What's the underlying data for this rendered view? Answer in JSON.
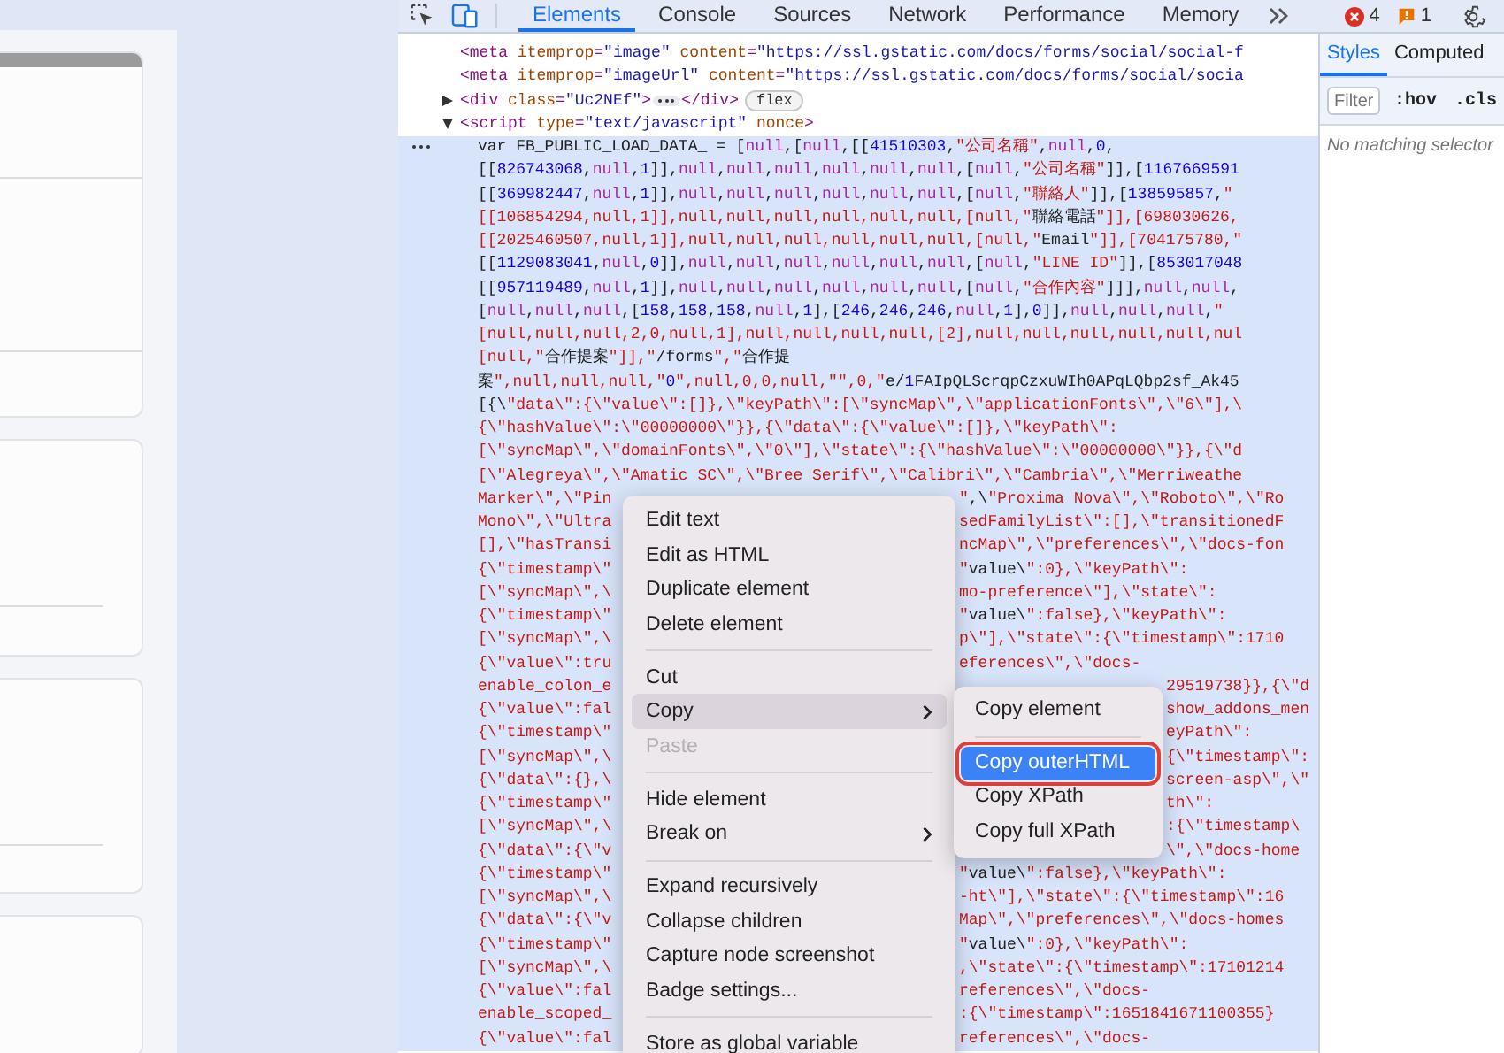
{
  "toolbar": {
    "tabs": [
      {
        "label": "Elements",
        "selected": true
      },
      {
        "label": "Console",
        "selected": false
      },
      {
        "label": "Sources",
        "selected": false
      },
      {
        "label": "Network",
        "selected": false
      },
      {
        "label": "Performance",
        "selected": false
      },
      {
        "label": "Memory",
        "selected": false
      }
    ],
    "errors": "4",
    "warnings": "1"
  },
  "elements": {
    "nodes": [
      {
        "kind": "tag",
        "text": "<meta itemprop=\"image\" content=\"https://ssl.gstatic.com/docs/forms/social/social-f"
      },
      {
        "kind": "tag",
        "text": "<meta itemprop=\"imageUrl\" content=\"https://ssl.gstatic.com/docs/forms/social/socia"
      },
      {
        "kind": "collapsed",
        "expanded": false,
        "text": "<div class=\"Uc2NEf\">",
        "close": "</div>",
        "badge": "flex"
      },
      {
        "kind": "parent",
        "expanded": true,
        "text": "<script type=\"text/javascript\" nonce>"
      }
    ],
    "text_node": {
      "selected": true,
      "lines": [
        {
          "kind": "full",
          "text": "var FB_PUBLIC_LOAD_DATA_ = [null,[null,[[41510303,\"公司名稱\",null,0,"
        },
        {
          "kind": "full",
          "text": "[[826743068,null,1]],null,null,null,null,null,null,[null,\"公司名稱\"]],[1167669591"
        },
        {
          "kind": "full",
          "text": "[[369982447,null,1]],null,null,null,null,null,null,[null,\"聯絡人\"]],[138595857,\""
        },
        {
          "kind": "full",
          "text": "[[106854294,null,1]],null,null,null,null,null,null,[null,\"聯絡電話\"]],[698030626,"
        },
        {
          "kind": "full",
          "text": "[[2025460507,null,1]],null,null,null,null,null,null,[null,\"Email\"]],[704175780,\""
        },
        {
          "kind": "full",
          "text": "[[1129083041,null,0]],null,null,null,null,null,null,[null,\"LINE ID\"]],[853017048"
        },
        {
          "kind": "full",
          "text": "[[957119489,null,1]],null,null,null,null,null,null,[null,\"合作內容\"]]],null,null,"
        },
        {
          "kind": "full",
          "text": "[null,null,null,[158,158,158,null,1],[246,246,246,null,1],0]],null,null,null,\""
        },
        {
          "kind": "full",
          "text": "[null,null,null,2,0,null,1],null,null,null,null,[2],null,null,null,null,null,nul"
        },
        {
          "kind": "full",
          "text": "[null,\"合作提案\"]],\"/forms\",\"合作提"
        },
        {
          "kind": "full",
          "text": "案\",null,null,null,\"0\",null,0,0,null,\"\",0,\"e/1FAIpQLScrqpCzxuWIh0APqLQbp2sf_Ak45"
        },
        {
          "kind": "full",
          "text": "[{\\\"data\\\":{\\\"value\\\":[]},\\\"keyPath\\\":[\\\"syncMap\\\",\\\"applicationFonts\\\",\\\"6\\\"],\\"
        },
        {
          "kind": "full",
          "text": "{\\\"hashValue\\\":\\\"00000000\\\"}},{\\\"data\\\":{\\\"value\\\":[]},\\\"keyPath\\\":"
        },
        {
          "kind": "full",
          "text": "[\\\"syncMap\\\",\\\"domainFonts\\\",\\\"0\\\"],\\\"state\\\":{\\\"hashValue\\\":\\\"00000000\\\"}},{\\\"d"
        },
        {
          "kind": "full",
          "text": "[\\\"Alegreya\\\",\\\"Amatic SC\\\",\\\"Bree Serif\\\",\\\"Calibri\\\",\\\"Cambria\\\",\\\"Merriweathe"
        },
        {
          "kind": "menu",
          "left": "Marker\\\",\\\"Pin",
          "right": "\",\\\"Proxima Nova\\\",\\\"Roboto\\\",\\\"Ro"
        },
        {
          "kind": "menu",
          "left": "Mono\\\",\\\"Ultra",
          "right": "sedFamilyList\\\":[],\\\"transitionedF"
        },
        {
          "kind": "menu",
          "left": "[],\\\"hasTransi",
          "right": "ncMap\\\",\\\"preferences\\\",\\\"docs-fon"
        },
        {
          "kind": "menu",
          "left": "{\\\"timestamp\\\"",
          "right": "\"value\\\":0},\\\"keyPath\\\":"
        },
        {
          "kind": "menu",
          "left": "[\\\"syncMap\\\",\\",
          "right": "mo-preference\\\"],\\\"state\\\":"
        },
        {
          "kind": "menu",
          "left": "{\\\"timestamp\\\"",
          "right": "\"value\\\":false},\\\"keyPath\\\":"
        },
        {
          "kind": "menu",
          "left": "[\\\"syncMap\\\",\\",
          "right": "p\\\"],\\\"state\\\":{\\\"timestamp\\\":1710"
        },
        {
          "kind": "menu",
          "left": "{\\\"value\\\":tru",
          "right": "eferences\\\",\\\"docs-"
        },
        {
          "kind": "submenu",
          "left": "enable_colon_e",
          "right": "29519738}},{\\\"d"
        },
        {
          "kind": "submenu",
          "left": "{\\\"value\\\":fal",
          "right": "show_addons_men"
        },
        {
          "kind": "submenu",
          "left": "{\\\"timestamp\\\"",
          "right": "eyPath\\\":"
        },
        {
          "kind": "submenu",
          "left": "[\\\"syncMap\\\",\\",
          "right": "{\\\"timestamp\\\":"
        },
        {
          "kind": "submenu",
          "left": "{\\\"data\\\":{},\\",
          "right": "screen-asp\\\",\\\""
        },
        {
          "kind": "submenu",
          "left": "{\\\"timestamp\\\"",
          "right": "th\\\":"
        },
        {
          "kind": "submenu",
          "left": "[\\\"syncMap\\\",\\",
          "right": ":{\\\"timestamp\\"
        },
        {
          "kind": "submenu",
          "left": "{\\\"data\\\":{\\\"v",
          "right": "\\\",\\\"docs-home"
        },
        {
          "kind": "menu",
          "left": "{\\\"timestamp\\\"",
          "right": "\"value\\\":false},\\\"keyPath\\\":"
        },
        {
          "kind": "menu",
          "left": "[\\\"syncMap\\\",\\",
          "right": "-ht\\\"],\\\"state\\\":{\\\"timestamp\\\":16"
        },
        {
          "kind": "menu",
          "left": "{\\\"data\\\":{\\\"v",
          "right": "Map\\\",\\\"preferences\\\",\\\"docs-homes"
        },
        {
          "kind": "menu",
          "left": "{\\\"timestamp\\\"",
          "right": "\"value\\\":0},\\\"keyPath\\\":"
        },
        {
          "kind": "menu",
          "left": "[\\\"syncMap\\\",\\",
          "right": ",\\\"state\\\":{\\\"timestamp\\\":17101214"
        },
        {
          "kind": "menu",
          "left": "{\\\"value\\\":fal",
          "right": "references\\\",\\\"docs-"
        },
        {
          "kind": "menu",
          "left": "enable_scoped_",
          "right": ":{\\\"timestamp\\\":1651841671100355}"
        },
        {
          "kind": "menu",
          "left": "{\\\"value\\\":fal",
          "right": "references\\\",\\\"docs-"
        }
      ]
    }
  },
  "context_menu": {
    "items": [
      {
        "kind": "item",
        "label": "Edit text",
        "highlighted": false,
        "disabled": false,
        "submenu": false
      },
      {
        "kind": "item",
        "label": "Edit as HTML",
        "highlighted": false,
        "disabled": false,
        "submenu": false
      },
      {
        "kind": "item",
        "label": "Duplicate element",
        "highlighted": false,
        "disabled": false,
        "submenu": false
      },
      {
        "kind": "item",
        "label": "Delete element",
        "highlighted": false,
        "disabled": false,
        "submenu": false
      },
      {
        "kind": "separator"
      },
      {
        "kind": "item",
        "label": "Cut",
        "highlighted": false,
        "disabled": false,
        "submenu": false
      },
      {
        "kind": "item",
        "label": "Copy",
        "highlighted": true,
        "disabled": false,
        "submenu": true
      },
      {
        "kind": "item",
        "label": "Paste",
        "highlighted": false,
        "disabled": true,
        "submenu": false
      },
      {
        "kind": "separator"
      },
      {
        "kind": "item",
        "label": "Hide element",
        "highlighted": false,
        "disabled": false,
        "submenu": false
      },
      {
        "kind": "item",
        "label": "Break on",
        "highlighted": false,
        "disabled": false,
        "submenu": true
      },
      {
        "kind": "separator"
      },
      {
        "kind": "item",
        "label": "Expand recursively",
        "highlighted": false,
        "disabled": false,
        "submenu": false
      },
      {
        "kind": "item",
        "label": "Collapse children",
        "highlighted": false,
        "disabled": false,
        "submenu": false
      },
      {
        "kind": "item",
        "label": "Capture node screenshot",
        "highlighted": false,
        "disabled": false,
        "submenu": false
      },
      {
        "kind": "item",
        "label": "Badge settings...",
        "highlighted": false,
        "disabled": false,
        "submenu": false
      },
      {
        "kind": "separator"
      },
      {
        "kind": "item",
        "label": "Store as global variable",
        "highlighted": false,
        "disabled": false,
        "submenu": false
      }
    ]
  },
  "copy_submenu": {
    "items": [
      {
        "kind": "item",
        "label": "Copy element",
        "highlighted": false,
        "outlined": false
      },
      {
        "kind": "separator"
      },
      {
        "kind": "item",
        "label": "Copy outerHTML",
        "highlighted": true,
        "outlined": true
      },
      {
        "kind": "item",
        "label": "Copy XPath",
        "highlighted": false,
        "outlined": false
      },
      {
        "kind": "item",
        "label": "Copy full XPath",
        "highlighted": false,
        "outlined": false
      }
    ]
  },
  "styles_pane": {
    "tabs": [
      {
        "label": "Styles",
        "selected": true
      },
      {
        "label": "Computed",
        "selected": false
      }
    ],
    "filter": {
      "placeholder": "Filter"
    },
    "toggles": [
      ":hov",
      ".cls"
    ],
    "empty_text": "No matching selector"
  }
}
